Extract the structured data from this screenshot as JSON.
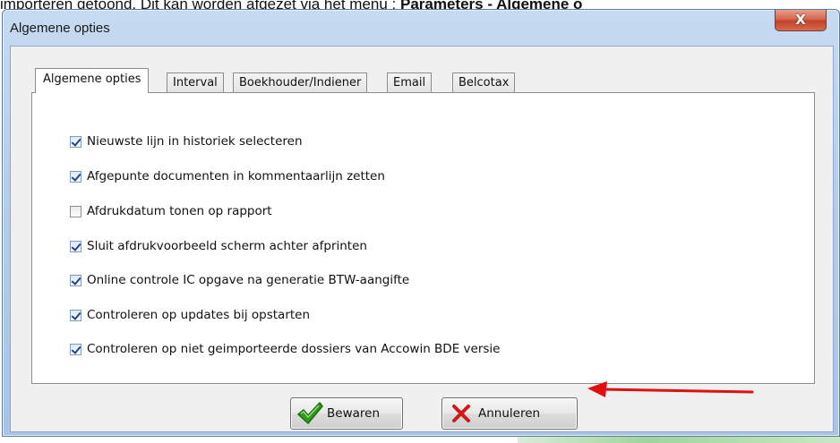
{
  "document": {
    "text_before": "importeren getoond. Dit kan worden afgezet via het menu : ",
    "bold_text": "Parameters - Algemene o"
  },
  "window": {
    "title": "Algemene opties",
    "close_label": "X"
  },
  "tabs": [
    {
      "label": "Algemene opties",
      "active": true
    },
    {
      "label": "Interval",
      "active": false
    },
    {
      "label": "Boekhouder/Indiener",
      "active": false
    },
    {
      "label": "Email",
      "active": false
    },
    {
      "label": "Belcotax",
      "active": false
    }
  ],
  "options": [
    {
      "label": "Nieuwste lijn in historiek selecteren",
      "checked": true
    },
    {
      "label": "Afgepunte documenten in kommentaarlijn zetten",
      "checked": true
    },
    {
      "label": "Afdrukdatum tonen op rapport",
      "checked": false
    },
    {
      "label": "Sluit afdrukvoorbeeld scherm achter afprinten",
      "checked": true
    },
    {
      "label": "Online controle IC opgave na generatie BTW-aangifte",
      "checked": true
    },
    {
      "label": "Controleren op updates bij opstarten",
      "checked": true
    },
    {
      "label": "Controleren op niet geimporteerde dossiers van Accowin BDE versie",
      "checked": true
    }
  ],
  "buttons": {
    "save_label": "Bewaren",
    "cancel_label": "Annuleren"
  },
  "icons": {
    "save": "checkmark-icon",
    "cancel": "cross-icon",
    "annotation": "red-arrow-icon"
  },
  "colors": {
    "arrow": "#e01010",
    "save_icon": "#2f9a1e",
    "cancel_icon": "#d01818",
    "checkmark": "#21409a"
  }
}
